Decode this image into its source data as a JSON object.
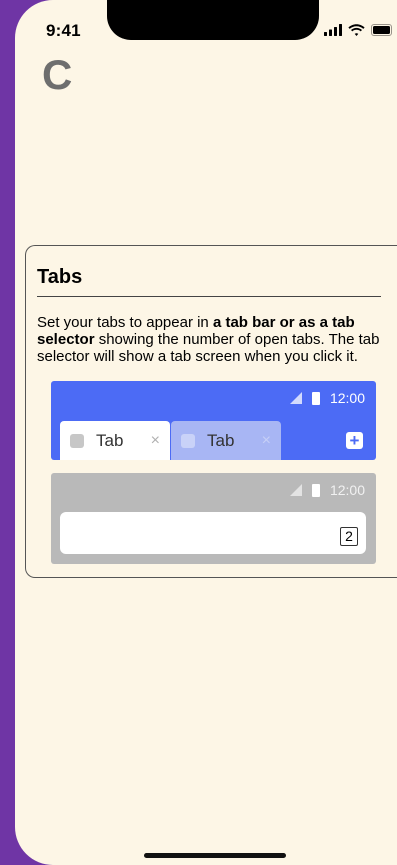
{
  "status_bar": {
    "time": "9:41"
  },
  "logo": {
    "letter": "C"
  },
  "card": {
    "title": "Tabs",
    "description": {
      "part1": "Set your tabs to appear in ",
      "bold": "a tab bar or as a tab selector",
      "part2": " showing the number of open tabs. The tab selector will show a tab screen when you click it."
    }
  },
  "preview_tab_bar": {
    "time": "12:00",
    "tabs": [
      {
        "label": "Tab",
        "close": "×",
        "state": "active"
      },
      {
        "label": "Tab",
        "close": "×",
        "state": "inactive"
      }
    ],
    "new_tab": "+",
    "background_color": "#4c6bf5"
  },
  "preview_tab_selector": {
    "time": "12:00",
    "tab_count": "2",
    "background_color": "#b9b9b9"
  },
  "colors": {
    "frame": "#6f35a5",
    "background": "#fdf6e6",
    "accent": "#4c6bf5"
  }
}
